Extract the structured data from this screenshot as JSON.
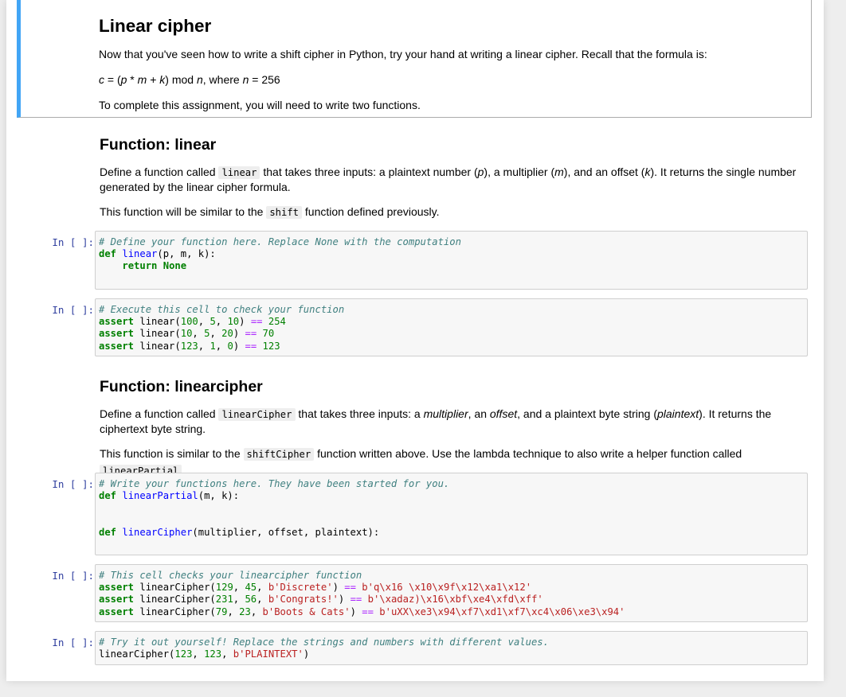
{
  "intro": {
    "title": "Linear cipher",
    "text1": "Now that you've seen how to write a shift cipher in Python, try your hand at writing a linear cipher. Recall that the formula is:",
    "formula": {
      "c": "c",
      "eq": " = (",
      "p": "p",
      "mul": " * ",
      "m": "m",
      "plus": " + ",
      "k": "k",
      "mod": ") mod ",
      "n": "n",
      "where": ", where ",
      "n2": "n",
      "val": " = 256"
    },
    "text2": "To complete this assignment, you will need to write two functions."
  },
  "func_linear": {
    "title": "Function: linear",
    "d1": "Define a function called ",
    "code1": "linear",
    "d2": " that takes three inputs: a plaintext number (",
    "p": "p",
    "d3": "), a multiplier (",
    "m": "m",
    "d4": "), and an offset (",
    "k": "k",
    "d5": "). It returns the single number generated by the linear cipher formula.",
    "s1": "This function will be similar to the ",
    "code2": "shift",
    "s2": " function defined previously."
  },
  "func_lc": {
    "title": "Function: linearcipher",
    "d1": "Define a function called ",
    "code1": "linearCipher",
    "d2": " that takes three inputs: a ",
    "i1": "multiplier",
    "d3": ", an ",
    "i2": "offset",
    "d4": ", and a plaintext byte string (",
    "i3": "plaintext",
    "d5": "). It returns the ciphertext byte string.",
    "s1": "This function is similar to the ",
    "code2": "shiftCipher",
    "s2": " function written above. Use the lambda technique to also write a helper function called ",
    "code3": "linearPartial",
    "s3": "."
  },
  "prompt": "In [ ]:",
  "code_cells": {
    "c1": {
      "comment": "# Define your function here. Replace None with the computation",
      "def": "def",
      "fname": "linear",
      "args": "(p, m, k):",
      "ret_kw": "return",
      "ret_val": "None"
    },
    "c2": {
      "comment": "# Execute this cell to check your function",
      "lines": [
        {
          "kw": "assert",
          "call": " linear(",
          "n1": "100",
          "s1": ", ",
          "n2": "5",
          "s2": ", ",
          "n3": "10",
          "s3": ") ",
          "op": "==",
          "sp": " ",
          "res": "254"
        },
        {
          "kw": "assert",
          "call": " linear(",
          "n1": "10",
          "s1": ", ",
          "n2": "5",
          "s2": ", ",
          "n3": "20",
          "s3": ") ",
          "op": "==",
          "sp": " ",
          "res": "70"
        },
        {
          "kw": "assert",
          "call": " linear(",
          "n1": "123",
          "s1": ", ",
          "n2": "1",
          "s2": ", ",
          "n3": "0",
          "s3": ") ",
          "op": "==",
          "sp": " ",
          "res": "123"
        }
      ]
    },
    "c3": {
      "comment": "# Write your functions here. They have been started for you.",
      "def1": "def",
      "f1": "linearPartial",
      "a1": "(m, k):",
      "def2": "def",
      "f2": "linearCipher",
      "a2": "(multiplier, offset, plaintext):"
    },
    "c4": {
      "comment": "# This cell checks your linearcipher function",
      "lines": [
        {
          "kw": "assert",
          "call": " linearCipher(",
          "n1": "129",
          "s1": ", ",
          "n2": "45",
          "s2": ", ",
          "str": "b'Discrete'",
          "s3": ") ",
          "op": "==",
          "sp": " ",
          "res": "b'q\\x16 \\x10\\x9f\\x12\\xa1\\x12'"
        },
        {
          "kw": "assert",
          "call": " linearCipher(",
          "n1": "231",
          "s1": ", ",
          "n2": "56",
          "s2": ", ",
          "str": "b'Congrats!'",
          "s3": ") ",
          "op": "==",
          "sp": " ",
          "res": "b'\\xadaz)\\x16\\xbf\\xe4\\xfd\\xff'"
        },
        {
          "kw": "assert",
          "call": " linearCipher(",
          "n1": "79",
          "s1": ", ",
          "n2": "23",
          "s2": ", ",
          "str": "b'Boots & Cats'",
          "s3": ") ",
          "op": "==",
          "sp": " ",
          "res": "b'uXX\\xe3\\x94\\xf7\\xd1\\xf7\\xc4\\x06\\xe3\\x94'"
        }
      ]
    },
    "c5": {
      "comment": "# Try it out yourself! Replace the strings and numbers with different values.",
      "call": "linearCipher(",
      "n1": "123",
      "s1": ", ",
      "n2": "123",
      "s2": ", ",
      "str": "b'PLAINTEXT'",
      "end": ")"
    }
  }
}
